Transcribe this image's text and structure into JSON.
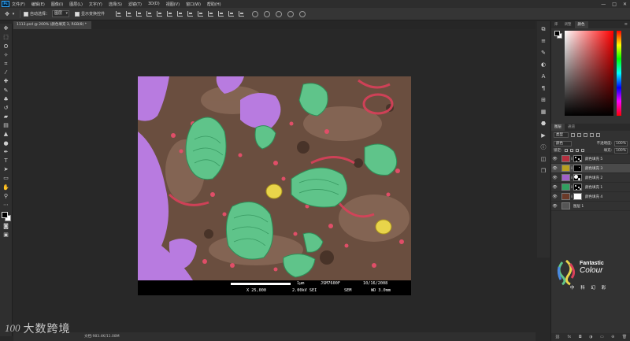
{
  "menubar": {
    "app_logo": "Ps",
    "items": [
      "文件(F)",
      "编辑(E)",
      "图像(I)",
      "图层(L)",
      "文字(Y)",
      "选择(S)",
      "滤镜(T)",
      "3D(D)",
      "视图(V)",
      "窗口(W)",
      "帮助(H)"
    ],
    "window_controls": [
      "—",
      "□",
      "✕"
    ]
  },
  "options": {
    "auto_select_label": "自动选择：",
    "auto_select_target": "图层",
    "transform_controls_label": "显示变换控件"
  },
  "document": {
    "tab_title": "1113.psd @ 200% (颜色填充 3, RGB/8) *",
    "status_text": "文档:983.4K/11.08M"
  },
  "sem_bar": {
    "scale": "1μm",
    "instrument": "JSM7600F",
    "date": "10/16/2008",
    "magnification": "X 25,000",
    "voltage": "2.00kV SEI",
    "mode": "SEM",
    "wd": "WD 3.0mm"
  },
  "panels": {
    "color_tabs": [
      "库",
      "调整",
      "颜色"
    ],
    "color_active": 2,
    "layer_tabs": [
      "图层",
      "通道"
    ],
    "layer_active": 0,
    "filter_kind": "类型",
    "blend_mode": "颜色",
    "opacity_label": "不透明度:",
    "opacity_value": "100%",
    "lock_label": "锁定:",
    "fill_label": "填充:",
    "fill_value": "100%",
    "layers": [
      {
        "name": "颜色填充 5",
        "color": "#b53040",
        "mask": "dots"
      },
      {
        "name": "颜色填充 3",
        "color": "#b8a020",
        "mask": "dark"
      },
      {
        "name": "颜色填充 2",
        "color": "#a060c8",
        "mask": "mixed"
      },
      {
        "name": "颜色填充 1",
        "color": "#30a060",
        "mask": "dots"
      },
      {
        "name": "颜色填充 4",
        "color": "#6b3a28",
        "mask": "white"
      },
      {
        "name": "图层 1",
        "color": "#555555",
        "mask": "none"
      }
    ],
    "selected_layer": 1
  },
  "logo": {
    "line1": "Fantastic",
    "line2": "Colour",
    "line3": "中 科 幻 彩"
  },
  "watermark": {
    "mark": "100",
    "text": "大数跨境"
  }
}
